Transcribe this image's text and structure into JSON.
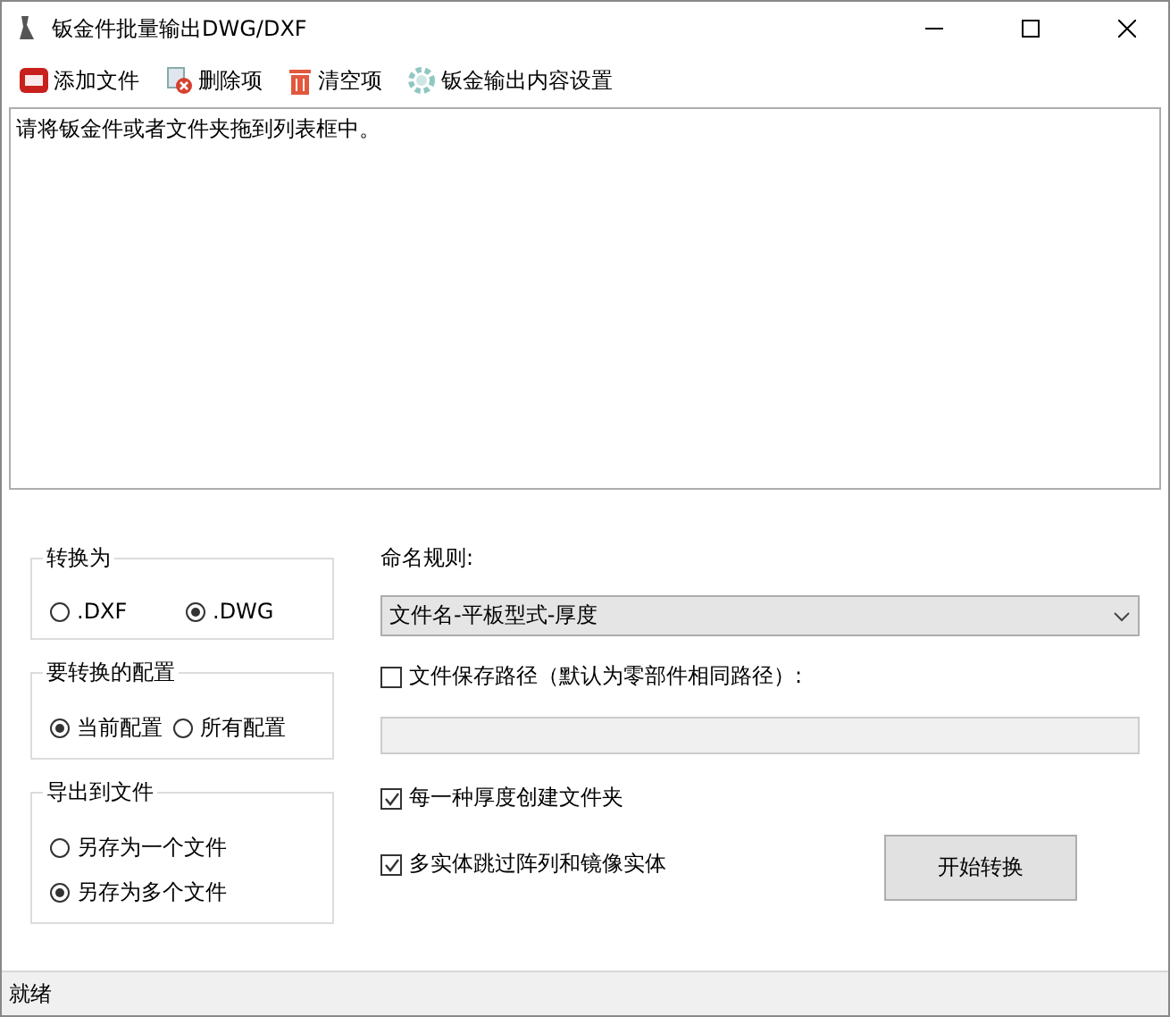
{
  "window": {
    "title": "钣金件批量输出DWG/DXF"
  },
  "toolbar": [
    {
      "kind": "sw",
      "label": "添加文件"
    },
    {
      "kind": "delete",
      "label": "删除项"
    },
    {
      "kind": "trash",
      "label": "清空项"
    },
    {
      "kind": "gear",
      "label": "钣金输出内容设置"
    }
  ],
  "list_box": {
    "text": "请将钣金件或者文件夹拖到列表框中。"
  },
  "groups": [
    {
      "title": "转换为",
      "kind": "row",
      "options": [
        {
          "label": ".DXF",
          "selected": false
        },
        {
          "label": ".DWG",
          "selected": true
        }
      ]
    },
    {
      "title": "要转换的配置",
      "kind": "row",
      "options": [
        {
          "label": "当前配置",
          "selected": true
        },
        {
          "label": "所有配置",
          "selected": false
        }
      ]
    },
    {
      "title": "导出到文件",
      "kind": "column",
      "options": [
        {
          "label": "另存为一个文件",
          "selected": false
        },
        {
          "label": "另存为多个文件",
          "selected": true
        }
      ]
    }
  ],
  "naming_rule": {
    "label": "命名规则:",
    "value": "文件名-平板型式-厚度"
  },
  "save_path": {
    "label": "文件保存路径（默认为零部件相同路径）:",
    "checked": false
  },
  "options": [
    {
      "label": "每一种厚度创建文件夹",
      "checked": true
    },
    {
      "label": "多实体跳过阵列和镜像实体",
      "checked": true
    }
  ],
  "start_button": "开始转换",
  "status_bar": "就绪"
}
